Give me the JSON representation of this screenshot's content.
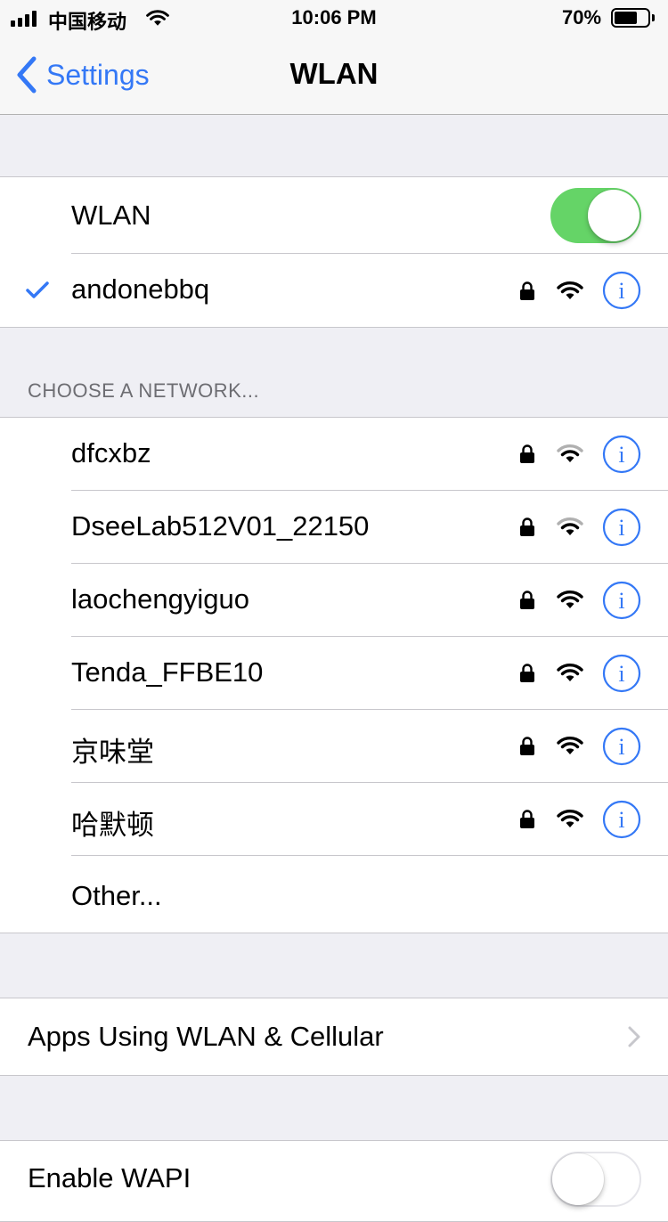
{
  "status_bar": {
    "carrier": "中国移动",
    "time": "10:06 PM",
    "battery_percent": "70%",
    "battery_level": 0.7
  },
  "nav": {
    "back_label": "Settings",
    "title": "WLAN"
  },
  "wlan": {
    "label": "WLAN",
    "enabled": true,
    "connected_network": "andonebbq"
  },
  "section_header": "CHOOSE A NETWORK...",
  "networks": [
    {
      "name": "dfcxbz",
      "locked": true,
      "signal": "weak"
    },
    {
      "name": "DseeLab512V01_22150",
      "locked": true,
      "signal": "weak"
    },
    {
      "name": "laochengyiguo",
      "locked": true,
      "signal": "strong"
    },
    {
      "name": "Tenda_FFBE10",
      "locked": true,
      "signal": "strong"
    },
    {
      "name": "京味堂",
      "locked": true,
      "signal": "strong"
    },
    {
      "name": "哈默顿",
      "locked": true,
      "signal": "strong"
    }
  ],
  "other_label": "Other...",
  "apps_using_label": "Apps Using WLAN & Cellular",
  "enable_wapi": {
    "label": "Enable WAPI",
    "enabled": false
  },
  "colors": {
    "accent": "#3478f6",
    "toggle_on": "#65d467",
    "toggle_off_border": "#e5e5ea",
    "weak_signal": "#b0b0b0"
  },
  "icons": {
    "check": "checkmark-icon",
    "lock": "lock-icon",
    "wifi": "wifi-icon",
    "info": "info-icon",
    "chevron": "chevron-right-icon",
    "back": "chevron-left-icon"
  }
}
